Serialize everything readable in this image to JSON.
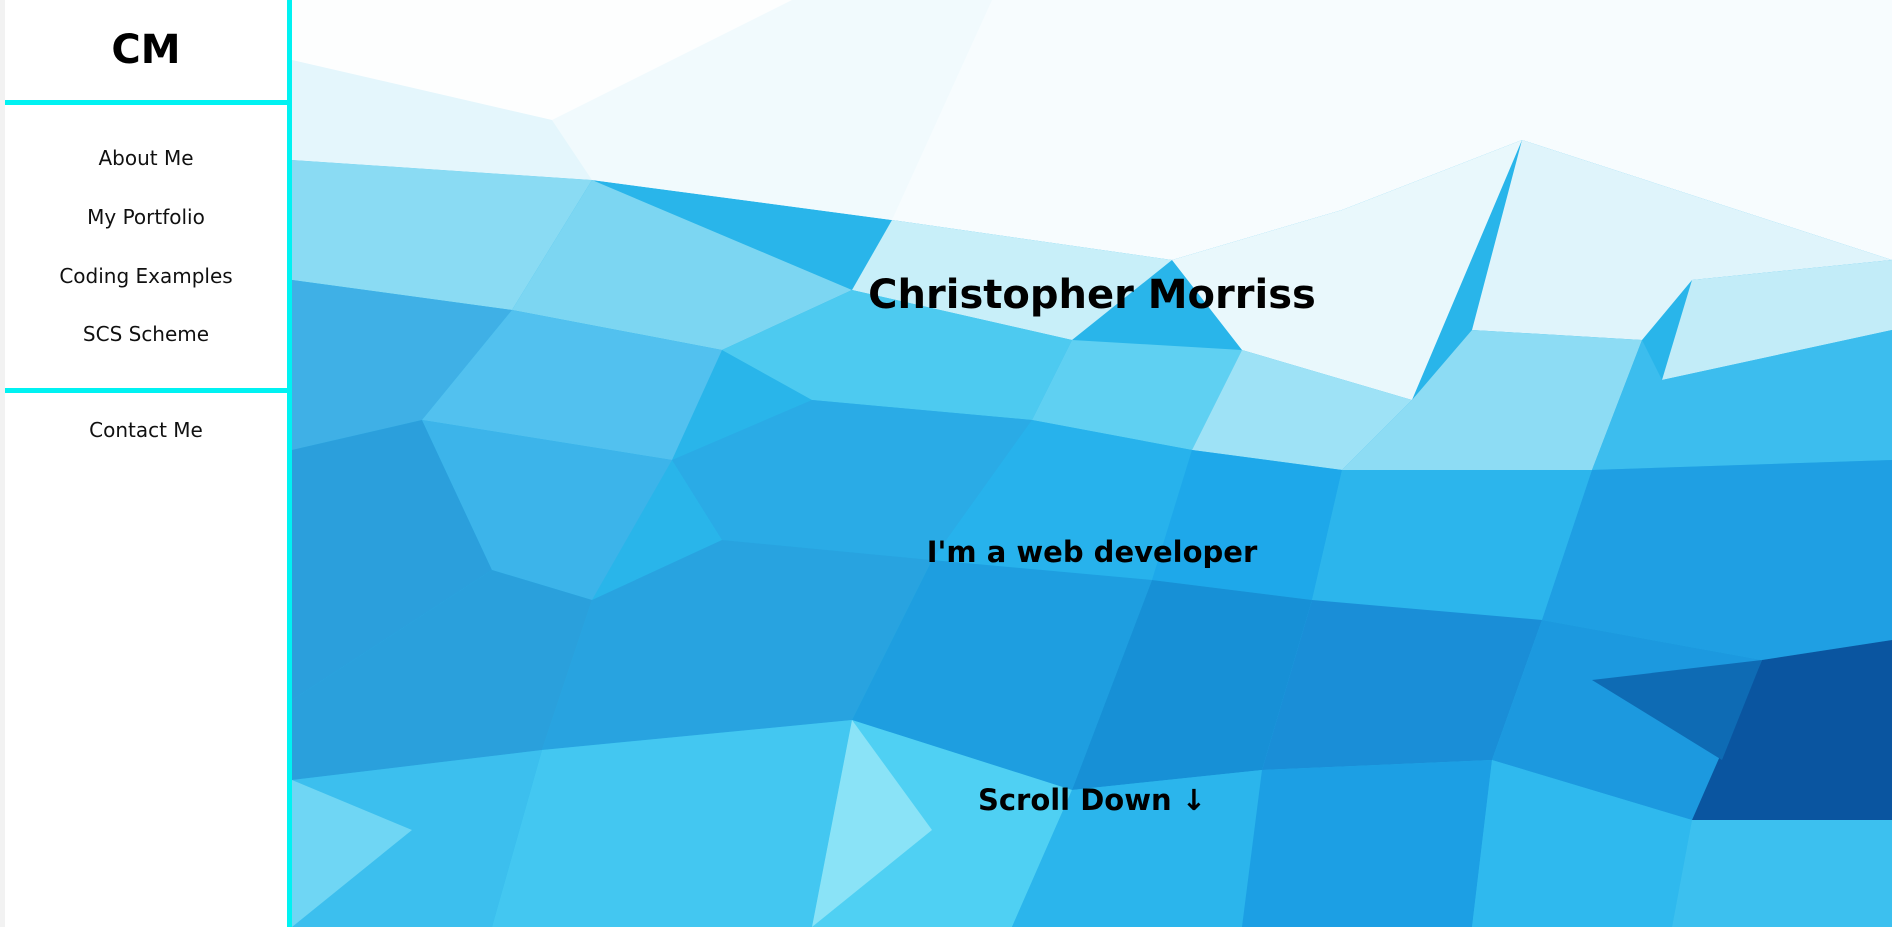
{
  "sidebar": {
    "logo": "CM",
    "nav_items": [
      {
        "label": "About Me"
      },
      {
        "label": "My Portfolio"
      },
      {
        "label": "Coding Examples"
      },
      {
        "label": "SCS Scheme"
      }
    ],
    "contact": {
      "label": "Contact Me"
    }
  },
  "hero": {
    "name": "Christopher Morriss",
    "tagline": "I'm a web developer",
    "scroll_label": "Scroll Down ↓"
  },
  "colors": {
    "accent": "#00f2f2",
    "hero_light": "#e8f9fd",
    "hero_mid": "#2bc3f0",
    "hero_dark": "#0b5fa8"
  }
}
